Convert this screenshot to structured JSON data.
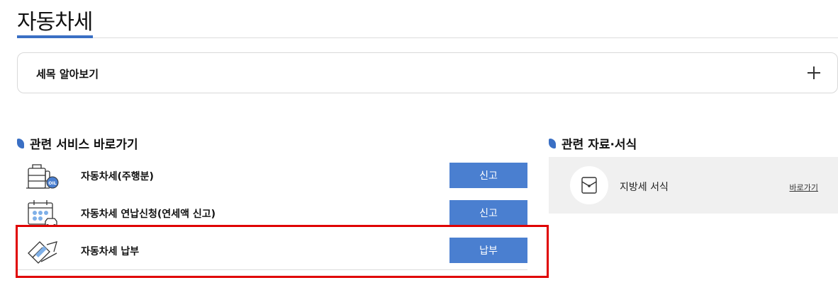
{
  "page": {
    "title": "자동차세"
  },
  "accordion": {
    "label": "세목 알아보기"
  },
  "related_services": {
    "title": "관련 서비스 바로가기",
    "items": [
      {
        "label": "자동차세(주행분)",
        "button": "신고",
        "icon": "fuel-tank-icon"
      },
      {
        "label": "자동차세 연납신청(연세액 신고)",
        "button": "신고",
        "icon": "calendar-car-icon"
      },
      {
        "label": "자동차세 납부",
        "button": "납부",
        "icon": "card-payment-icon"
      }
    ]
  },
  "related_forms": {
    "title": "관련 자료·서식",
    "items": [
      {
        "label": "지방세 서식",
        "link": "바로가기",
        "icon": "document-envelope-icon"
      }
    ]
  },
  "colors": {
    "accent": "#3a6fc4",
    "button": "#4a7fd0",
    "highlight": "#e00000"
  }
}
